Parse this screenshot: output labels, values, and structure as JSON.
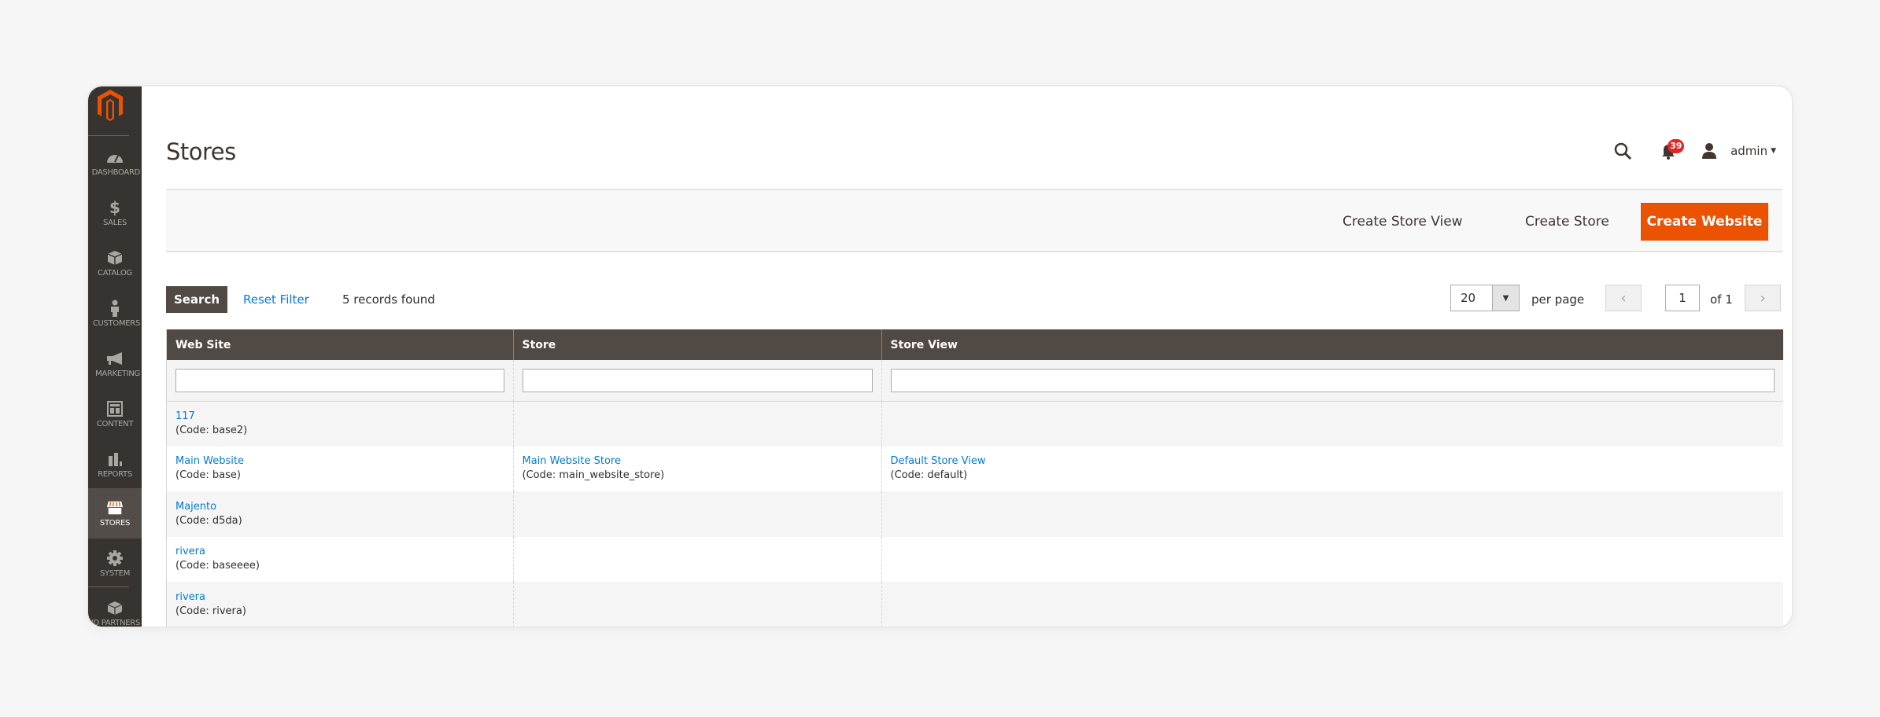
{
  "sidebar": {
    "logo": "magento-logo",
    "items": [
      {
        "label": "DASHBOARD",
        "icon": "dashboard-icon",
        "active": false
      },
      {
        "label": "SALES",
        "icon": "dollar-icon",
        "active": false
      },
      {
        "label": "CATALOG",
        "icon": "box-icon",
        "active": false
      },
      {
        "label": "CUSTOMERS",
        "icon": "person-icon",
        "active": false
      },
      {
        "label": "MARKETING",
        "icon": "megaphone-icon",
        "active": false
      },
      {
        "label": "CONTENT",
        "icon": "layout-icon",
        "active": false
      },
      {
        "label": "REPORTS",
        "icon": "bar-chart-icon",
        "active": false
      },
      {
        "label": "STORES",
        "icon": "storefront-icon",
        "active": true
      },
      {
        "label": "SYSTEM",
        "icon": "gear-icon",
        "active": false
      },
      {
        "label": "FIND PARTNERS",
        "icon": "partners-icon",
        "active": false
      }
    ]
  },
  "header": {
    "title": "Stores",
    "notifications_count": "39",
    "user": "admin"
  },
  "actions": {
    "create_store_view": "Create Store View",
    "create_store": "Create Store",
    "create_website": "Create Website"
  },
  "toolbar": {
    "search": "Search",
    "reset_filter": "Reset Filter",
    "records_found": "5 records found",
    "per_page_value": "20",
    "per_page_label": "per page",
    "current_page": "1",
    "page_of": "of 1"
  },
  "table": {
    "columns": [
      "Web Site",
      "Store",
      "Store View"
    ],
    "filters": [
      "",
      "",
      ""
    ],
    "rows": [
      {
        "website": "117",
        "website_code": "(Code: base2)",
        "store": "",
        "store_code": "",
        "store_view": "",
        "store_view_code": ""
      },
      {
        "website": "Main Website",
        "website_code": "(Code: base)",
        "store": "Main Website Store",
        "store_code": "(Code: main_website_store)",
        "store_view": "Default Store View",
        "store_view_code": "(Code: default)"
      },
      {
        "website": "Majento",
        "website_code": "(Code: d5da)",
        "store": "",
        "store_code": "",
        "store_view": "",
        "store_view_code": ""
      },
      {
        "website": "rivera",
        "website_code": "(Code: baseeee)",
        "store": "",
        "store_code": "",
        "store_view": "",
        "store_view_code": ""
      },
      {
        "website": "rivera",
        "website_code": "(Code: rivera)",
        "store": "",
        "store_code": "",
        "store_view": "",
        "store_view_code": ""
      }
    ]
  },
  "colors": {
    "sidebar_bg": "#373330",
    "sidebar_active": "#524d49",
    "brand_orange": "#eb5202",
    "header_bg": "#514943",
    "link": "#007bdb",
    "badge": "#e22626"
  }
}
